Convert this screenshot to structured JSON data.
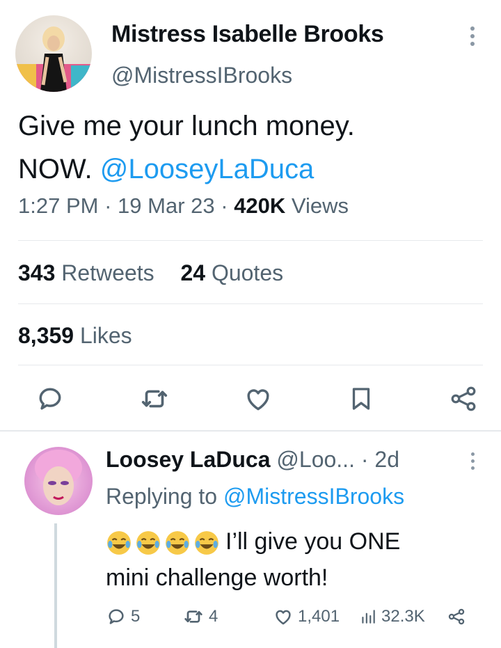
{
  "tweet": {
    "display_name": "Mistress Isabelle Brooks",
    "handle": "@MistressIBrooks",
    "text_line1": "Give me your lunch money.",
    "text_line2_prefix": "NOW.",
    "mention": "@LooseyLaDuca",
    "time": "1:27 PM",
    "date": "19 Mar 23",
    "views_count": "420K",
    "views_label": "Views",
    "separator": "·",
    "retweets_count": "343",
    "retweets_label": "Retweets",
    "quotes_count": "24",
    "quotes_label": "Quotes",
    "likes_count": "8,359",
    "likes_label": "Likes",
    "actions": [
      "reply-icon",
      "retweet-icon",
      "like-icon",
      "bookmark-icon",
      "share-icon"
    ]
  },
  "reply": {
    "display_name": "Loosey LaDuca",
    "handle_truncated": "@Loo...",
    "separator": "·",
    "age": "2d",
    "replying_prefix": "Replying to",
    "replying_handle": "@MistressIBrooks",
    "emojis": [
      "tears-of-joy-emoji",
      "tears-of-joy-emoji",
      "tears-of-joy-emoji",
      "tears-of-joy-emoji"
    ],
    "text_line1": "I’ll give you ONE",
    "text_line2": "mini challenge worth!",
    "reply_count": "5",
    "retweet_count": "4",
    "like_count": "1,401",
    "views_count": "32.3K"
  },
  "colors": {
    "link": "#1d9bf0",
    "text": "#0f1419",
    "muted": "#536471",
    "divider": "#e6e9ec"
  }
}
